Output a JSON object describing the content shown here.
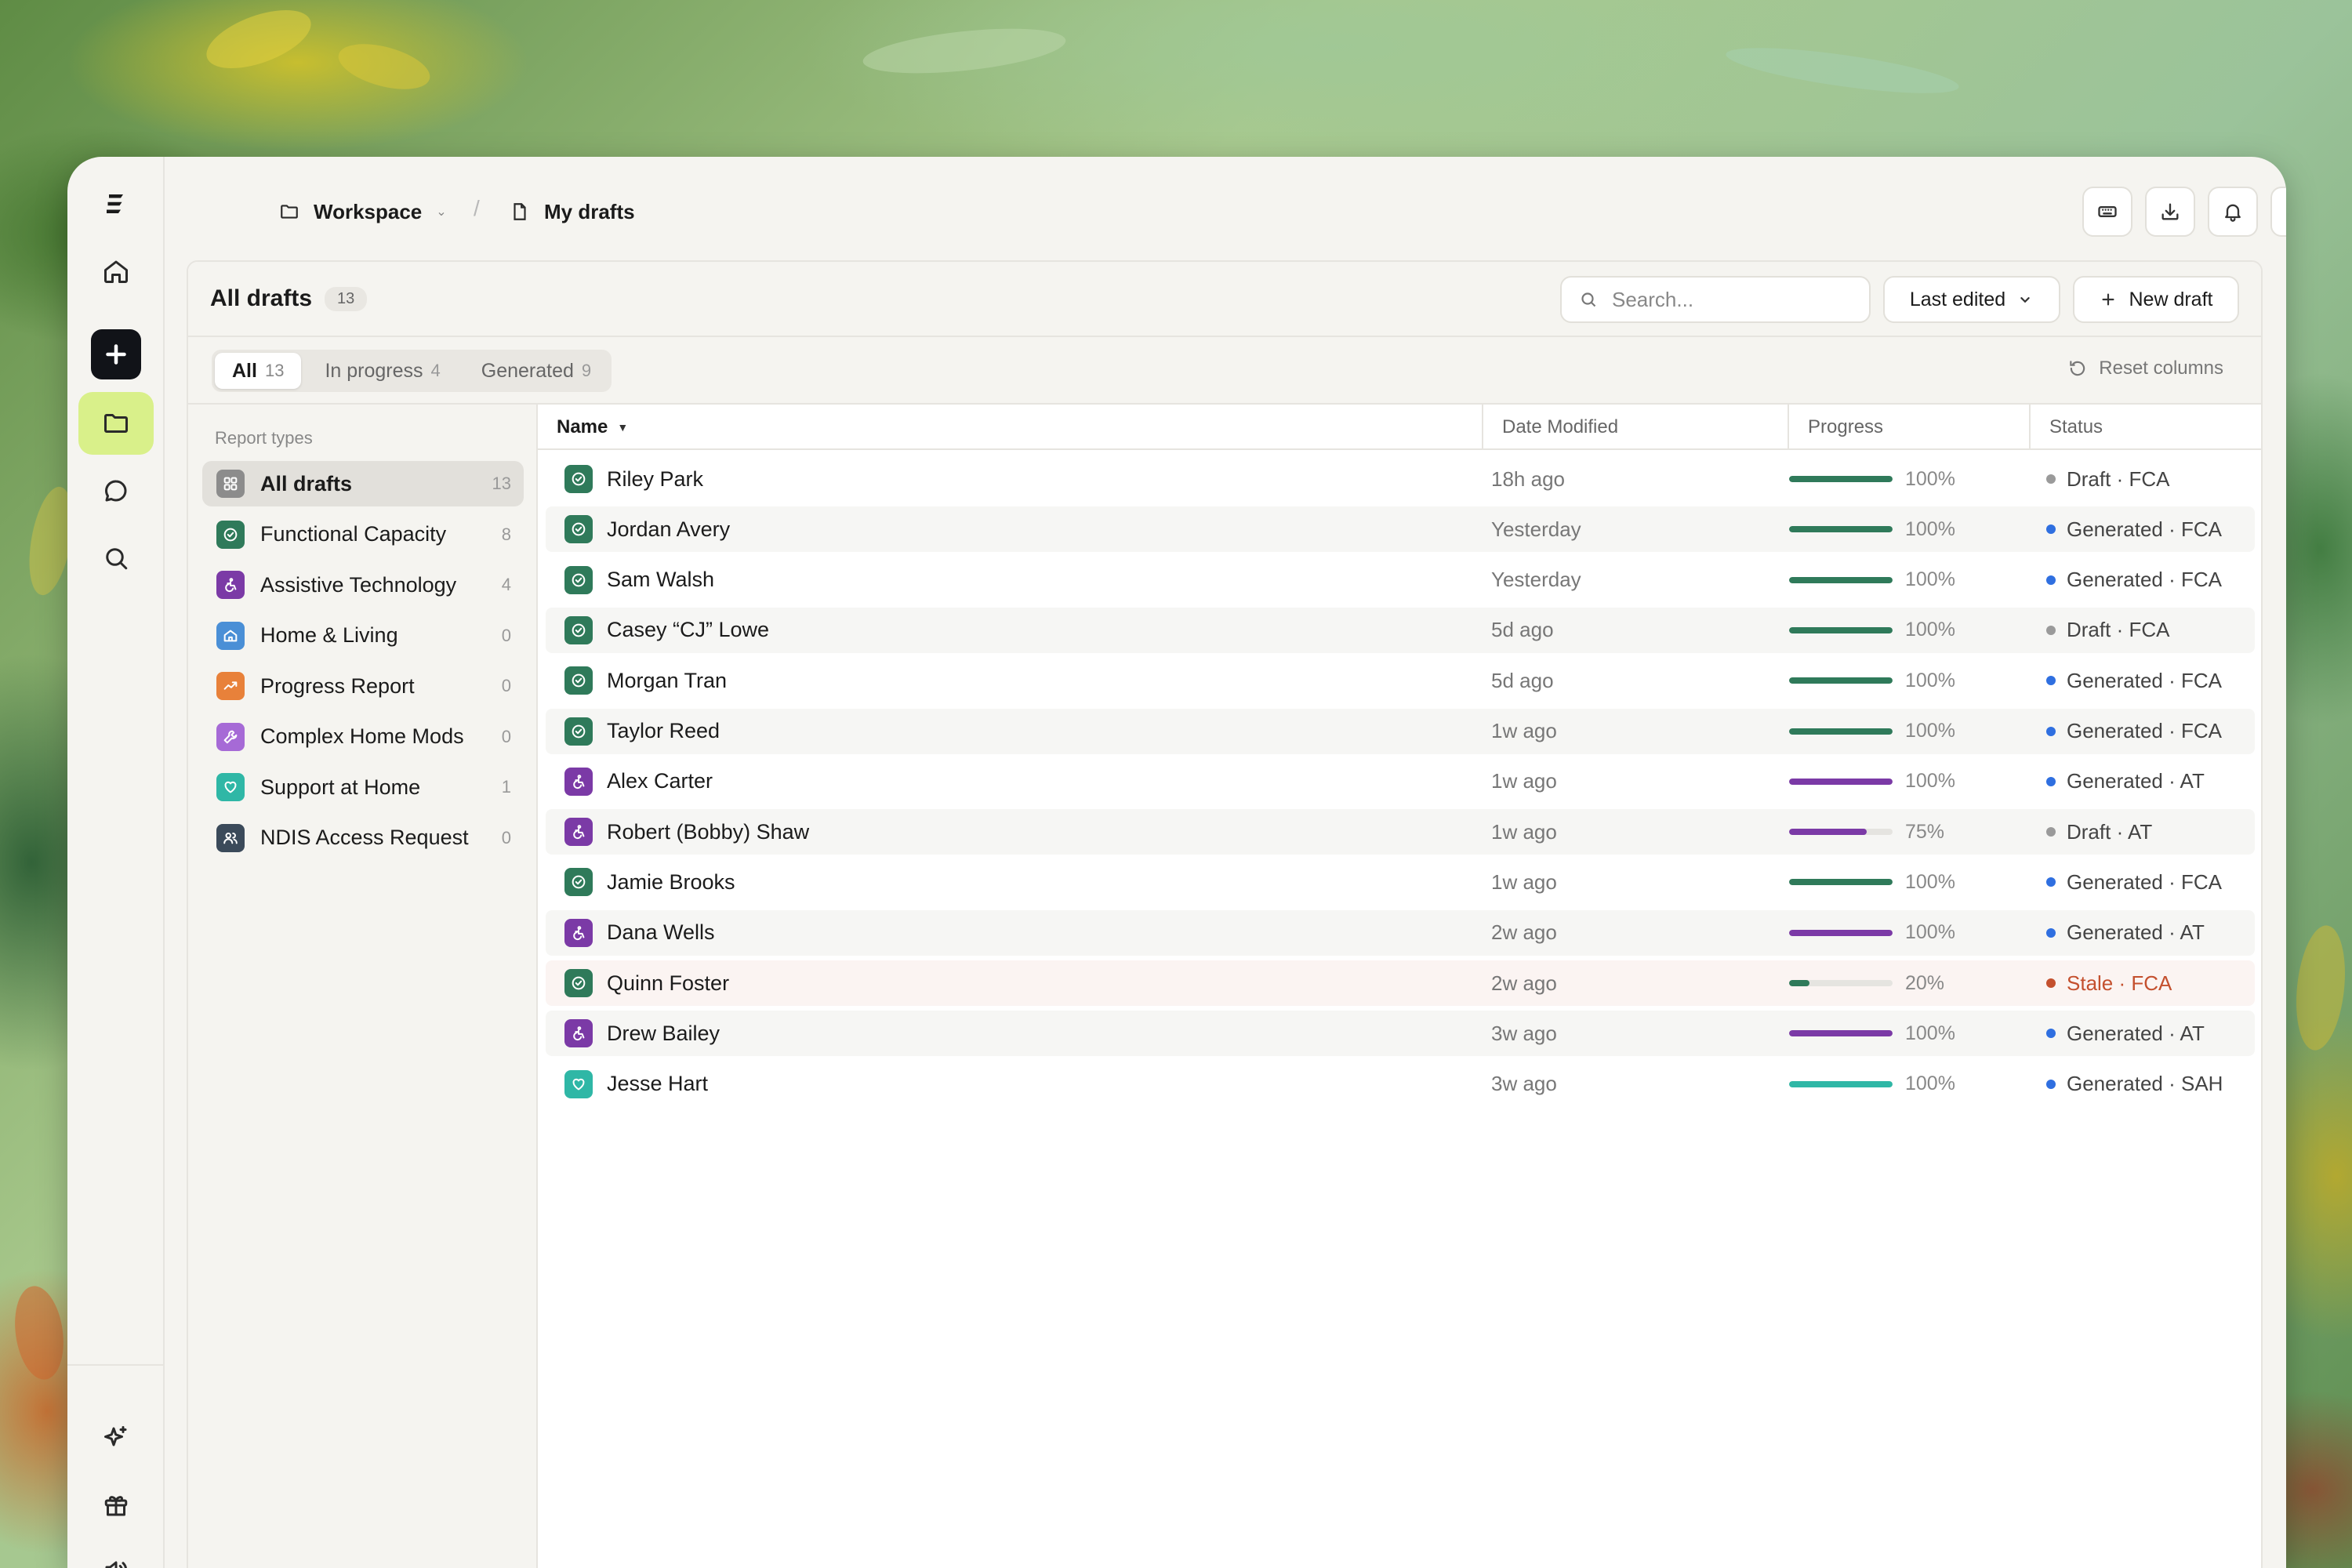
{
  "colors": {
    "fca": "#2f7a5a",
    "at": "#7b3aa6",
    "home": "#4a8fd6",
    "progress": "#e8813a",
    "complex": "#a66ad6",
    "sah": "#2fb7a6",
    "ndis": "#3b4a5a",
    "all": "#8c8c8c",
    "draft_dot": "#9a9a9a",
    "generated_dot": "#2f6fe0",
    "stale_dot": "#c4502e",
    "stale_text": "#c4502e",
    "accent": "#d9f08a"
  },
  "rail": {
    "items": [
      "logo-icon",
      "home-icon",
      "plus-icon",
      "folder-icon",
      "chat-icon",
      "search-icon",
      "sparkle-icon",
      "gift-icon",
      "speaker-icon"
    ]
  },
  "breadcrumb": {
    "workspace": "Workspace",
    "separator": "/",
    "page": "My drafts"
  },
  "toolbar": {
    "icons": [
      "keyboard-icon",
      "download-icon",
      "bell-icon",
      "contrast-icon"
    ]
  },
  "panel": {
    "title": "All drafts",
    "count": "13",
    "search_placeholder": "Search...",
    "sort_label": "Last edited",
    "new_label": "New draft",
    "reset_label": "Reset columns"
  },
  "filters": [
    {
      "label": "All",
      "count": "13",
      "active": true
    },
    {
      "label": "In progress",
      "count": "4",
      "active": false
    },
    {
      "label": "Generated",
      "count": "9",
      "active": false
    }
  ],
  "sidebar": {
    "heading": "Report types",
    "items": [
      {
        "label": "All drafts",
        "count": "13",
        "icon": "grid-icon",
        "color": "#8c8c8c",
        "active": true
      },
      {
        "label": "Functional Capacity",
        "count": "8",
        "icon": "check-circle-icon",
        "color": "#2f7a5a",
        "active": false
      },
      {
        "label": "Assistive Technology",
        "count": "4",
        "icon": "wheelchair-icon",
        "color": "#7b3aa6",
        "active": false
      },
      {
        "label": "Home & Living",
        "count": "0",
        "icon": "house-icon",
        "color": "#4a8fd6",
        "active": false
      },
      {
        "label": "Progress Report",
        "count": "0",
        "icon": "trend-icon",
        "color": "#e8813a",
        "active": false
      },
      {
        "label": "Complex Home Mods",
        "count": "0",
        "icon": "wrench-icon",
        "color": "#a66ad6",
        "active": false
      },
      {
        "label": "Support at Home",
        "count": "1",
        "icon": "heart-icon",
        "color": "#2fb7a6",
        "active": false
      },
      {
        "label": "NDIS Access Request",
        "count": "0",
        "icon": "users-icon",
        "color": "#3b4a5a",
        "active": false
      }
    ]
  },
  "table": {
    "columns": [
      "Name",
      "Date Modified",
      "Progress",
      "Status"
    ],
    "rows": [
      {
        "name": "Riley Park",
        "date": "18h ago",
        "progress": 100,
        "progress_label": "100%",
        "status": "Draft · FCA",
        "kind": "fca",
        "state": "draft"
      },
      {
        "name": "Jordan Avery",
        "date": "Yesterday",
        "progress": 100,
        "progress_label": "100%",
        "status": "Generated · FCA",
        "kind": "fca",
        "state": "generated"
      },
      {
        "name": "Sam Walsh",
        "date": "Yesterday",
        "progress": 100,
        "progress_label": "100%",
        "status": "Generated · FCA",
        "kind": "fca",
        "state": "generated"
      },
      {
        "name": "Casey “CJ” Lowe",
        "date": "5d ago",
        "progress": 100,
        "progress_label": "100%",
        "status": "Draft · FCA",
        "kind": "fca",
        "state": "draft"
      },
      {
        "name": "Morgan Tran",
        "date": "5d ago",
        "progress": 100,
        "progress_label": "100%",
        "status": "Generated · FCA",
        "kind": "fca",
        "state": "generated"
      },
      {
        "name": "Taylor Reed",
        "date": "1w ago",
        "progress": 100,
        "progress_label": "100%",
        "status": "Generated · FCA",
        "kind": "fca",
        "state": "generated"
      },
      {
        "name": "Alex Carter",
        "date": "1w ago",
        "progress": 100,
        "progress_label": "100%",
        "status": "Generated · AT",
        "kind": "at",
        "state": "generated"
      },
      {
        "name": "Robert (Bobby) Shaw",
        "date": "1w ago",
        "progress": 75,
        "progress_label": "75%",
        "status": "Draft · AT",
        "kind": "at",
        "state": "draft"
      },
      {
        "name": "Jamie Brooks",
        "date": "1w ago",
        "progress": 100,
        "progress_label": "100%",
        "status": "Generated · FCA",
        "kind": "fca",
        "state": "generated"
      },
      {
        "name": "Dana Wells",
        "date": "2w ago",
        "progress": 100,
        "progress_label": "100%",
        "status": "Generated · AT",
        "kind": "at",
        "state": "generated"
      },
      {
        "name": "Quinn Foster",
        "date": "2w ago",
        "progress": 20,
        "progress_label": "20%",
        "status": "Stale · FCA",
        "kind": "fca",
        "state": "stale"
      },
      {
        "name": "Drew Bailey",
        "date": "3w ago",
        "progress": 100,
        "progress_label": "100%",
        "status": "Generated · AT",
        "kind": "at",
        "state": "generated"
      },
      {
        "name": "Jesse Hart",
        "date": "3w ago",
        "progress": 100,
        "progress_label": "100%",
        "status": "Generated · SAH",
        "kind": "sah",
        "state": "generated"
      }
    ]
  }
}
